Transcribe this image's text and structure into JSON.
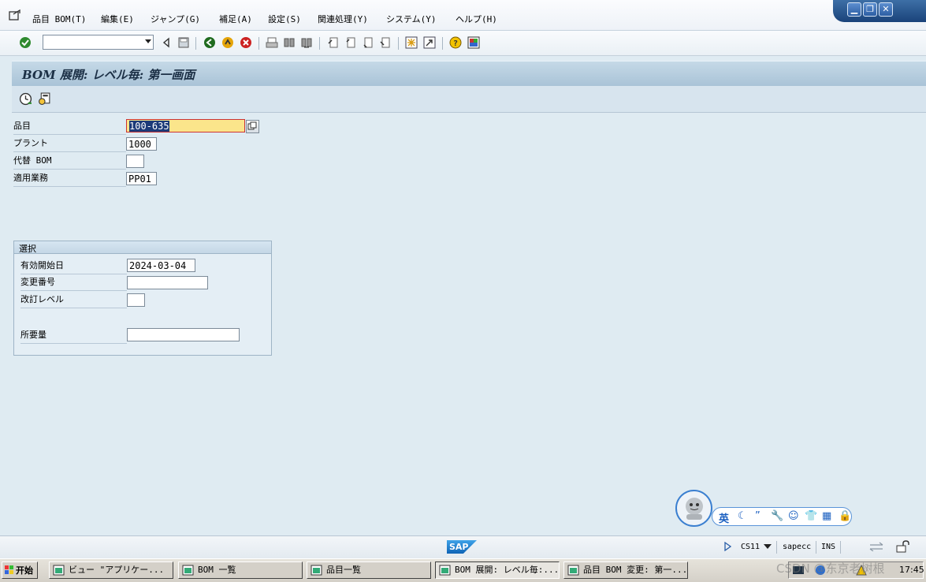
{
  "menu": [
    "品目 BOM(T)",
    "編集(E)",
    "ジャンプ(G)",
    "補足(A)",
    "設定(S)",
    "関連処理(Y)",
    "システム(Y)",
    "ヘルプ(H)"
  ],
  "window_controls": [
    "minimize",
    "restore",
    "close"
  ],
  "toolbar": {
    "command_field": "",
    "icons": [
      "enter-check-icon",
      "back-arrow-icon",
      "save-icon",
      "back-green-icon",
      "exit-yellow-icon",
      "cancel-red-icon",
      "print-icon",
      "find-icon",
      "find-next-icon",
      "first-page-icon",
      "prev-page-icon",
      "next-page-icon",
      "last-page-icon",
      "new-session-icon",
      "shortcut-icon",
      "help-icon",
      "layout-icon"
    ]
  },
  "page": {
    "title": "BOM 展開: レベル毎: 第一画面",
    "app_icons": [
      "execute-icon",
      "variant-icon"
    ]
  },
  "form": {
    "material_label": "品目",
    "material_value": "100-635",
    "plant_label": "プラント",
    "plant_value": "1000",
    "alt_bom_label": "代替 BOM",
    "alt_bom_value": "",
    "bom_usage_label": "適用業務",
    "bom_usage_value": "PP01"
  },
  "selection": {
    "header": "選択",
    "valid_from_label": "有効開始日",
    "valid_from_value": "2024-03-04",
    "change_no_label": "変更番号",
    "change_no_value": "",
    "revision_label": "改訂レベル",
    "revision_value": "",
    "required_qty_label": "所要量",
    "required_qty_value": ""
  },
  "ime": {
    "mode": "英",
    "icons": [
      "moon-icon",
      "punctuation-icon",
      "wrench-icon",
      "smiley-icon",
      "shirt-icon",
      "grid-icon",
      "lock-icon"
    ]
  },
  "status": {
    "logo": "SAP",
    "transaction": "CS11",
    "server": "sapecc",
    "mode": "INS"
  },
  "taskbar": {
    "start": "开始",
    "tasks": [
      "ビュー \"アプリケー...",
      "BOM 一覧",
      "品目一覧",
      "BOM 展開: レベル毎:...",
      "品目 BOM 変更: 第一..."
    ],
    "clock": "17:45",
    "watermark": "CSDN @东京老树根"
  },
  "colors": {
    "background": "#dfebf2",
    "title_band": "#b6cddf",
    "required_field": "#fbe58b",
    "selection_highlight": "#1c3a78"
  }
}
